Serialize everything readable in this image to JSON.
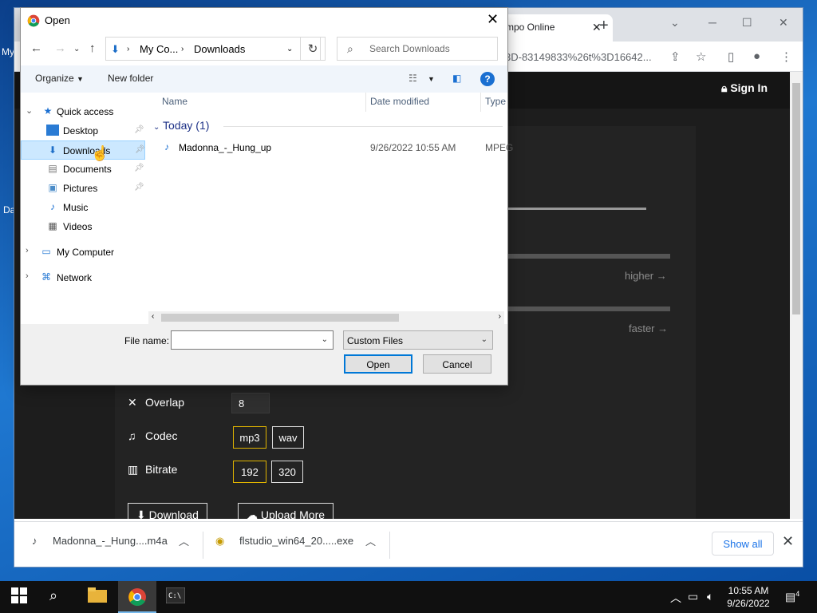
{
  "desktop": {
    "label_top": "My",
    "label_mid": "Da"
  },
  "browser": {
    "tab_title": "mpo Online",
    "tab_close": "✕",
    "new_tab": "+",
    "url": "3D-83149833%26t%3D16642...",
    "site": {
      "sign_in": "Sign In",
      "higher_hint": "higher →",
      "faster_hint": "faster →",
      "overlap_label": "Overlap",
      "overlap_value": "8",
      "codec_label": "Codec",
      "codec_options": [
        "mp3",
        "wav"
      ],
      "bitrate_label": "Bitrate",
      "bitrate_options": [
        "192",
        "320"
      ],
      "download_button": "Download",
      "upload_more_button": "Upload More"
    },
    "downloads_bar": {
      "items": [
        "Madonna_-_Hung....m4a",
        "flstudio_win64_20.....exe"
      ],
      "show_all": "Show all"
    }
  },
  "dialog": {
    "title": "Open",
    "breadcrumb": [
      "My Co...",
      "Downloads"
    ],
    "search_placeholder": "Search Downloads",
    "toolbar": {
      "organize": "Organize",
      "new_folder": "New folder"
    },
    "nav": {
      "quick_access": "Quick access",
      "items": [
        "Desktop",
        "Downloads",
        "Documents",
        "Pictures",
        "Music",
        "Videos"
      ],
      "my_computer": "My Computer",
      "network": "Network"
    },
    "columns": {
      "name": "Name",
      "date_modified": "Date modified",
      "type": "Type"
    },
    "group": "Today (1)",
    "files": [
      {
        "name": "Madonna_-_Hung_up",
        "date": "9/26/2022 10:55 AM",
        "type": "MPEG"
      }
    ],
    "file_name_label": "File name:",
    "file_name_value": "",
    "file_type": "Custom Files",
    "open_button": "Open",
    "cancel_button": "Cancel"
  },
  "taskbar": {
    "time": "10:55 AM",
    "date": "9/26/2022",
    "notification_count": "4"
  },
  "colors": {
    "accent": "#0078d7",
    "selection": "#cce8ff",
    "site_bg": "#1d1d1d",
    "highlight_border": "#e0b400"
  }
}
